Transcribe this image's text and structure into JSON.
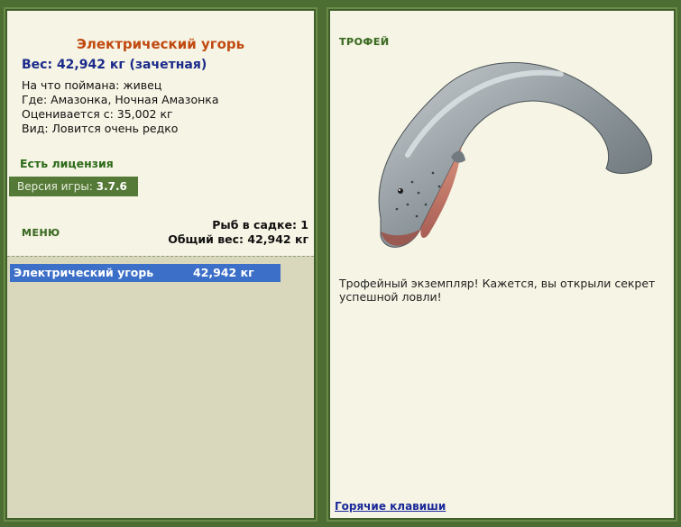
{
  "fish": {
    "name": "Электрический угорь",
    "weight_line": "Вес: 42,942 кг (зачетная)",
    "details": [
      "На что поймана: живец",
      "Где: Амазонка, Ночная Амазонка",
      "Оценивается с: 35,002 кг",
      "Вид: Ловится очень редко"
    ]
  },
  "license": "Есть лицензия",
  "version": {
    "label": "Версия игры:",
    "value": "3.7.6"
  },
  "menu_label": "МЕНЮ",
  "totals": {
    "count_line": "Рыб в садке: 1",
    "weight_line": "Общий вес: 42,942 кг"
  },
  "catch_list": [
    {
      "name": "Электрический угорь",
      "weight": "42,942 кг"
    }
  ],
  "trophy": {
    "label": "ТРОФЕЙ",
    "text": "Трофейный экземпляр! Кажется, вы открыли секрет успешной ловли!"
  },
  "hotkeys_label": "Горячие клавиши",
  "colors": {
    "background": "#4d6e33",
    "panel": "#f6f4e4",
    "fish_title": "#c04a10",
    "weight_text": "#1a2a8a",
    "selected_row": "#3c6fc8"
  }
}
